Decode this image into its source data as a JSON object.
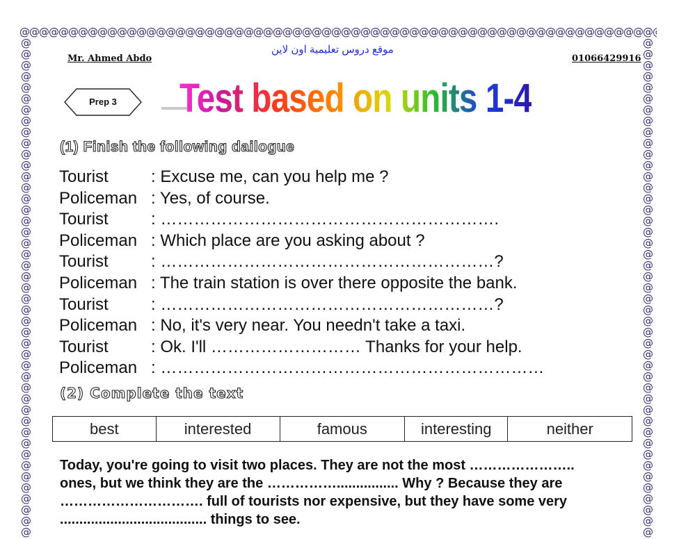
{
  "border": {
    "glyph": "@"
  },
  "header": {
    "author": "Mr. Ahmed Abdo",
    "site_arabic": "موقع دروس تعليمية اون لاين",
    "phone": "01066429916"
  },
  "badge": {
    "label": "Prep 3"
  },
  "title": "Test based on units 1-4",
  "section1": {
    "heading": "(1) Finish the following dailogue",
    "lines": [
      {
        "speaker": "Tourist",
        "text": ":  Excuse me, can you help me ?"
      },
      {
        "speaker": "Policeman",
        "text": ": Yes, of course."
      },
      {
        "speaker": "Tourist",
        "text": ": ……………………………………………………."
      },
      {
        "speaker": "Policeman",
        "text": ": Which place are you asking about ?"
      },
      {
        "speaker": "Tourist",
        "text": ": ……………………………………………………?"
      },
      {
        "speaker": "Policeman",
        "text": ": The train station is over there opposite the bank."
      },
      {
        "speaker": "Tourist",
        "text": ": ……………………………………………………?"
      },
      {
        "speaker": "Policeman",
        "text": ": No, it's very near. You needn't take a taxi."
      },
      {
        "speaker": "Tourist",
        "text": ": Ok. I'll ……………………… Thanks for your help."
      },
      {
        "speaker": "Policeman",
        "text": ": ……………………………………………………………"
      }
    ]
  },
  "section2": {
    "heading": "(2) Complete the text",
    "words": [
      "best",
      "interested",
      "famous",
      "interesting",
      "neither"
    ],
    "paragraph": [
      "Today, you're going to visit two places. They are not the most …………………..",
      "ones, but we think they are the ……………................ Why ? Because they are",
      "…………………………. full of tourists nor expensive, but they have some very",
      "...................................... things to see."
    ]
  }
}
